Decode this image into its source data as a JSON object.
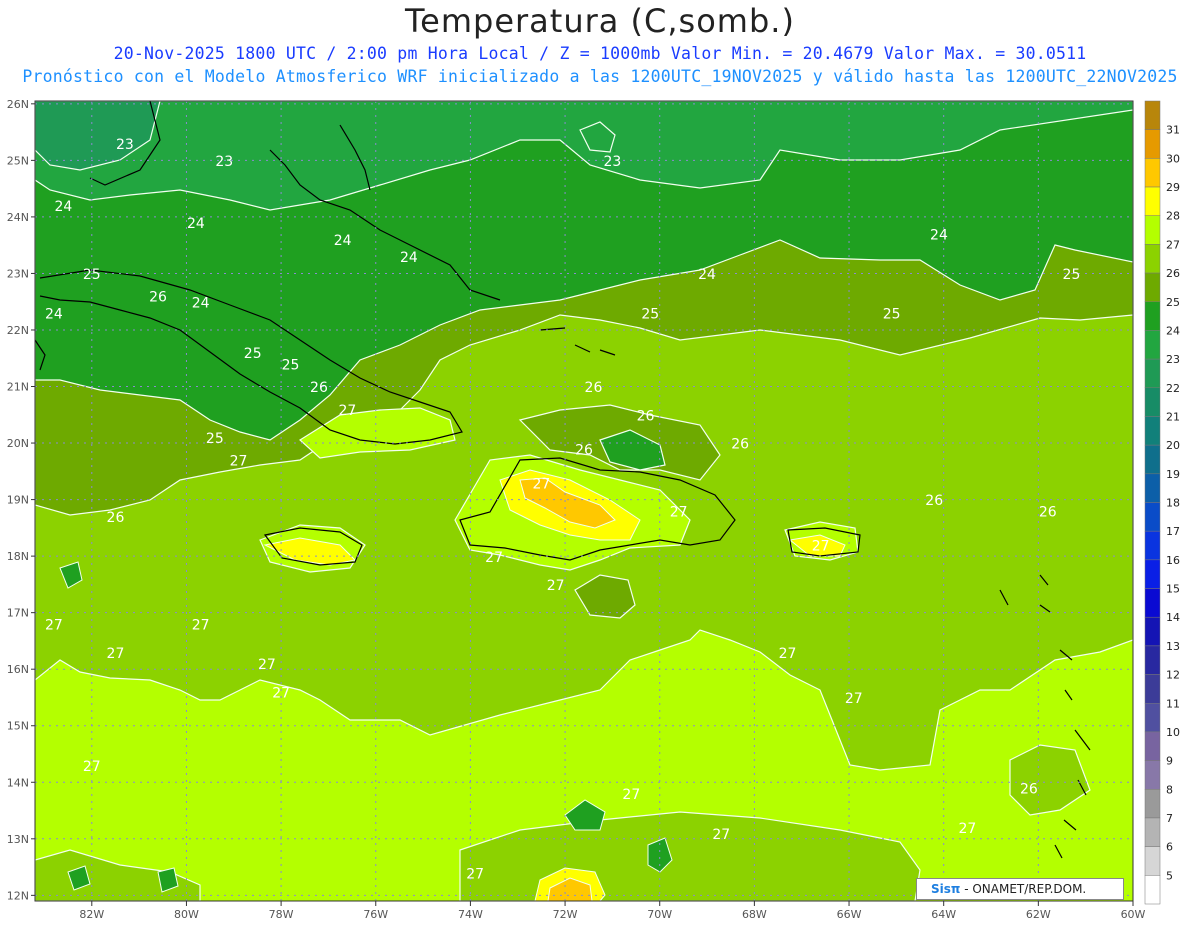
{
  "title": "Temperatura (C,somb.)",
  "subtitle_1": "20-Nov-2025  1800 UTC / 2:00 pm Hora Local / Z = 1000mb   Valor Min. = 20.4679  Valor Max. = 30.0511",
  "subtitle_2": "Pronóstico con el Modelo Atmosferico WRF inicializado a las 1200UTC_19NOV2025 y válido hasta las  1200UTC_22NOV2025",
  "credit": {
    "brand": "Sisπ",
    "text": " - ONAMET/REP.DOM."
  },
  "axes": {
    "lon_labels": [
      "82W",
      "80W",
      "78W",
      "76W",
      "74W",
      "72W",
      "70W",
      "68W",
      "66W",
      "64W",
      "62W",
      "60W"
    ],
    "lat_labels": [
      "26N",
      "25N",
      "24N",
      "23N",
      "22N",
      "21N",
      "20N",
      "19N",
      "18N",
      "17N",
      "16N",
      "15N",
      "14N",
      "13N",
      "12N"
    ],
    "lon_range": [
      -83.2,
      -60
    ],
    "lat_range": [
      11.9,
      26.05
    ]
  },
  "colorbar": {
    "labels": [
      "31",
      "30",
      "29",
      "28",
      "27",
      "26",
      "25",
      "24",
      "23",
      "22",
      "21",
      "20",
      "19",
      "18",
      "17",
      "16",
      "15",
      "14",
      "13",
      "12",
      "11",
      "10",
      "9",
      "8",
      "7",
      "6",
      "5"
    ],
    "colors": [
      "#b8860b",
      "#e69a00",
      "#ffc800",
      "#ffff00",
      "#b4ff00",
      "#8cd200",
      "#6eaa00",
      "#1fa020",
      "#22a640",
      "#1f9a55",
      "#178c66",
      "#11807a",
      "#0f6f8c",
      "#0c5fa8",
      "#0a4cc8",
      "#0a34e0",
      "#0a1fe6",
      "#0a0ad2",
      "#1414b4",
      "#2828a0",
      "#3c3c98",
      "#5050a0",
      "#7864a0",
      "#8878a8",
      "#9a9a9a",
      "#b4b4b4",
      "#d6d6d6",
      "#ffffff"
    ]
  },
  "contour_labels": [
    {
      "text": "23",
      "lon": -81.3,
      "lat": 25.2
    },
    {
      "text": "23",
      "lon": -79.2,
      "lat": 24.9
    },
    {
      "text": "23",
      "lon": -71.0,
      "lat": 24.9
    },
    {
      "text": "24",
      "lon": -82.6,
      "lat": 24.1
    },
    {
      "text": "24",
      "lon": -79.8,
      "lat": 23.8
    },
    {
      "text": "24",
      "lon": -76.7,
      "lat": 23.5
    },
    {
      "text": "24",
      "lon": -75.3,
      "lat": 23.2
    },
    {
      "text": "24",
      "lon": -69.0,
      "lat": 22.9
    },
    {
      "text": "24",
      "lon": -64.1,
      "lat": 23.6
    },
    {
      "text": "25",
      "lon": -82.0,
      "lat": 22.9
    },
    {
      "text": "25",
      "lon": -70.2,
      "lat": 22.2
    },
    {
      "text": "25",
      "lon": -65.1,
      "lat": 22.2
    },
    {
      "text": "25",
      "lon": -61.3,
      "lat": 22.9
    },
    {
      "text": "25",
      "lon": -78.6,
      "lat": 21.5
    },
    {
      "text": "25",
      "lon": -77.8,
      "lat": 21.3
    },
    {
      "text": "25",
      "lon": -79.4,
      "lat": 20.0
    },
    {
      "text": "24",
      "lon": -82.8,
      "lat": 22.2
    },
    {
      "text": "24",
      "lon": -79.7,
      "lat": 22.4
    },
    {
      "text": "26",
      "lon": -80.6,
      "lat": 22.5
    },
    {
      "text": "26",
      "lon": -77.2,
      "lat": 20.9
    },
    {
      "text": "26",
      "lon": -71.4,
      "lat": 20.9
    },
    {
      "text": "26",
      "lon": -70.3,
      "lat": 20.4
    },
    {
      "text": "26",
      "lon": -71.6,
      "lat": 19.8
    },
    {
      "text": "26",
      "lon": -68.3,
      "lat": 19.9
    },
    {
      "text": "26",
      "lon": -64.2,
      "lat": 18.9
    },
    {
      "text": "26",
      "lon": -61.8,
      "lat": 18.7
    },
    {
      "text": "26",
      "lon": -81.5,
      "lat": 18.6
    },
    {
      "text": "26",
      "lon": -62.2,
      "lat": 13.8
    },
    {
      "text": "27",
      "lon": -76.6,
      "lat": 20.5
    },
    {
      "text": "27",
      "lon": -78.9,
      "lat": 19.6
    },
    {
      "text": "27",
      "lon": -72.5,
      "lat": 19.2
    },
    {
      "text": "27",
      "lon": -69.6,
      "lat": 18.7
    },
    {
      "text": "27",
      "lon": -66.6,
      "lat": 18.1
    },
    {
      "text": "27",
      "lon": -73.5,
      "lat": 17.9
    },
    {
      "text": "27",
      "lon": -72.2,
      "lat": 17.4
    },
    {
      "text": "27",
      "lon": -82.8,
      "lat": 16.7
    },
    {
      "text": "27",
      "lon": -79.7,
      "lat": 16.7
    },
    {
      "text": "27",
      "lon": -81.5,
      "lat": 16.2
    },
    {
      "text": "27",
      "lon": -78.3,
      "lat": 16.0
    },
    {
      "text": "27",
      "lon": -78.0,
      "lat": 15.5
    },
    {
      "text": "27",
      "lon": -67.3,
      "lat": 16.2
    },
    {
      "text": "27",
      "lon": -65.9,
      "lat": 15.4
    },
    {
      "text": "27",
      "lon": -82.0,
      "lat": 14.2
    },
    {
      "text": "27",
      "lon": -70.6,
      "lat": 13.7
    },
    {
      "text": "27",
      "lon": -68.7,
      "lat": 13.0
    },
    {
      "text": "27",
      "lon": -63.5,
      "lat": 13.1
    },
    {
      "text": "27",
      "lon": -73.9,
      "lat": 12.3
    }
  ]
}
